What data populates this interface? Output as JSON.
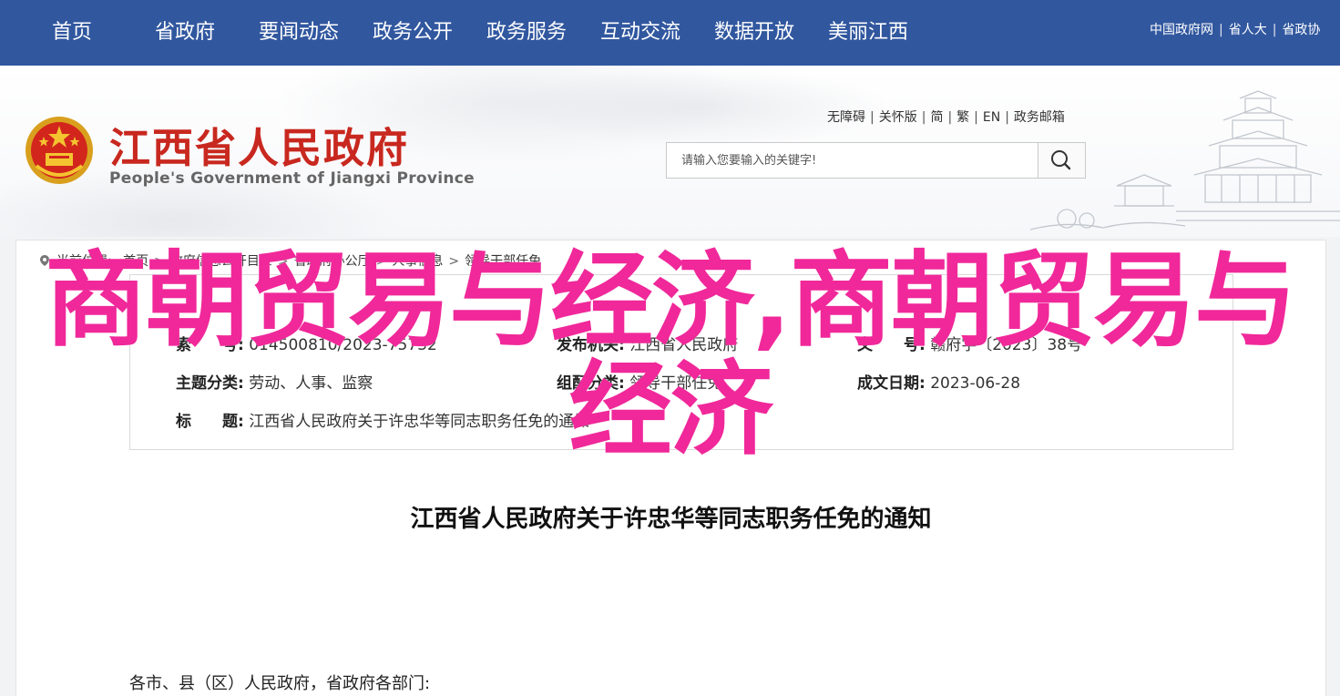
{
  "nav": {
    "items": [
      "首页",
      "省政府",
      "要闻动态",
      "政务公开",
      "政务服务",
      "互动交流",
      "数据开放",
      "美丽江西"
    ],
    "top_links": [
      "中国政府网",
      "省人大",
      "省政协"
    ]
  },
  "header": {
    "site_name_cn": "江西省人民政府",
    "site_name_en": "People's Government of Jiangxi Province",
    "util_links": [
      "无障碍",
      "关怀版",
      "简",
      "繁",
      "EN",
      "政务邮箱"
    ],
    "search_placeholder": "请输入您要输入的关键字!"
  },
  "breadcrumb": {
    "prefix": "当前位置:",
    "items": [
      "首页",
      "政府信息公开目录",
      "省政府办公厅",
      "人事信息",
      "领导干部任免"
    ]
  },
  "info": {
    "index_label": "索　　号:",
    "index_value": "014500810/2023-75732",
    "publisher_label": "发布机关:",
    "publisher_value": "江西省人民政府",
    "docno_label": "文　　号:",
    "docno_value": "赣府字〔2023〕38号",
    "topic_label": "主题分类:",
    "topic_value": "劳动、人事、监察",
    "org_label": "组配分类:",
    "org_value": "领导干部任免",
    "date_label": "成文日期:",
    "date_value": "2023-06-28",
    "title_label": "标　　题:",
    "title_value": "江西省人民政府关于许忠华等同志职务任免的通知"
  },
  "article": {
    "title": "江西省人民政府关于许忠华等同志职务任免的通知",
    "salutation": "各市、县（区）人民政府，省政府各部门:"
  },
  "overlay_text": "商朝贸易与经济,商朝贸易与经济",
  "colors": {
    "nav_bg": "#31579f",
    "brand_red": "#c8281f",
    "overlay_pink": "#f0289a"
  }
}
